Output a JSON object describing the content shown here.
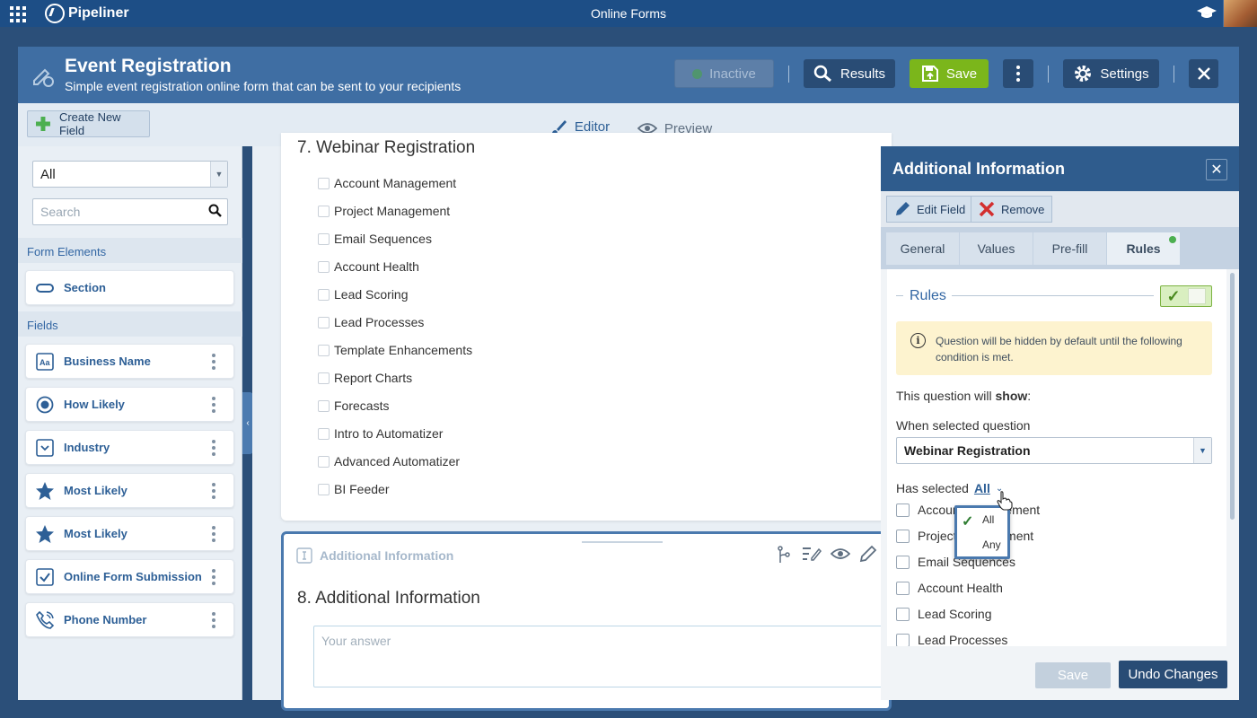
{
  "topbar": {
    "brand": "Pipeliner",
    "app_title": "Online Forms"
  },
  "header": {
    "title": "Event Registration",
    "subtitle": "Simple event registration online form that can be sent to your recipients",
    "inactive_label": "Inactive",
    "results_label": "Results",
    "save_label": "Save",
    "settings_label": "Settings"
  },
  "tabs": {
    "create_field": "Create New Field",
    "editor": "Editor",
    "preview": "Preview"
  },
  "sidebar": {
    "filter_value": "All",
    "search_placeholder": "Search",
    "form_elements_label": "Form Elements",
    "section_item": "Section",
    "fields_label": "Fields",
    "fields": [
      {
        "label": "Business Name",
        "icon": "text-field-icon"
      },
      {
        "label": "How Likely",
        "icon": "radio-icon"
      },
      {
        "label": "Industry",
        "icon": "dropdown-icon"
      },
      {
        "label": "Most Likely",
        "icon": "star-icon"
      },
      {
        "label": "Most Likely",
        "icon": "star-icon"
      },
      {
        "label": "Online Form Submission",
        "icon": "checkbox-icon"
      },
      {
        "label": "Phone Number",
        "icon": "phone-icon"
      }
    ]
  },
  "editor": {
    "q7": {
      "title": "7. Webinar Registration",
      "options": [
        "Account Management",
        "Project Management",
        "Email Sequences",
        "Account Health",
        "Lead Scoring",
        "Lead Processes",
        "Template Enhancements",
        "Report Charts",
        "Forecasts",
        "Intro to Automatizer",
        "Advanced Automatizer",
        "BI Feeder"
      ]
    },
    "q8": {
      "header": "Additional Information",
      "title": "8. Additional Information",
      "answer_placeholder": "Your answer"
    }
  },
  "panel": {
    "title": "Additional Information",
    "edit_field": "Edit Field",
    "remove": "Remove",
    "tabs": [
      "General",
      "Values",
      "Pre-fill",
      "Rules"
    ],
    "rules_label": "Rules",
    "info": "Question will be hidden by default until the following condition is met.",
    "will_show_prefix": "This question will ",
    "will_show_bold": "show",
    "will_show_suffix": ":",
    "when_label": "When selected question",
    "selected_question": "Webinar Registration",
    "has_selected": "Has selected",
    "match_mode": "All",
    "options": [
      "Account Management",
      "Project Management",
      "Email Sequences",
      "Account Health",
      "Lead Scoring",
      "Lead Processes"
    ],
    "dropdown": [
      "All",
      "Any"
    ],
    "footer_save": "Save",
    "footer_undo": "Undo Changes"
  },
  "colors": {
    "accent": "#2d5f96",
    "save_green": "#7bb61b",
    "header": "#3f6ea3"
  }
}
